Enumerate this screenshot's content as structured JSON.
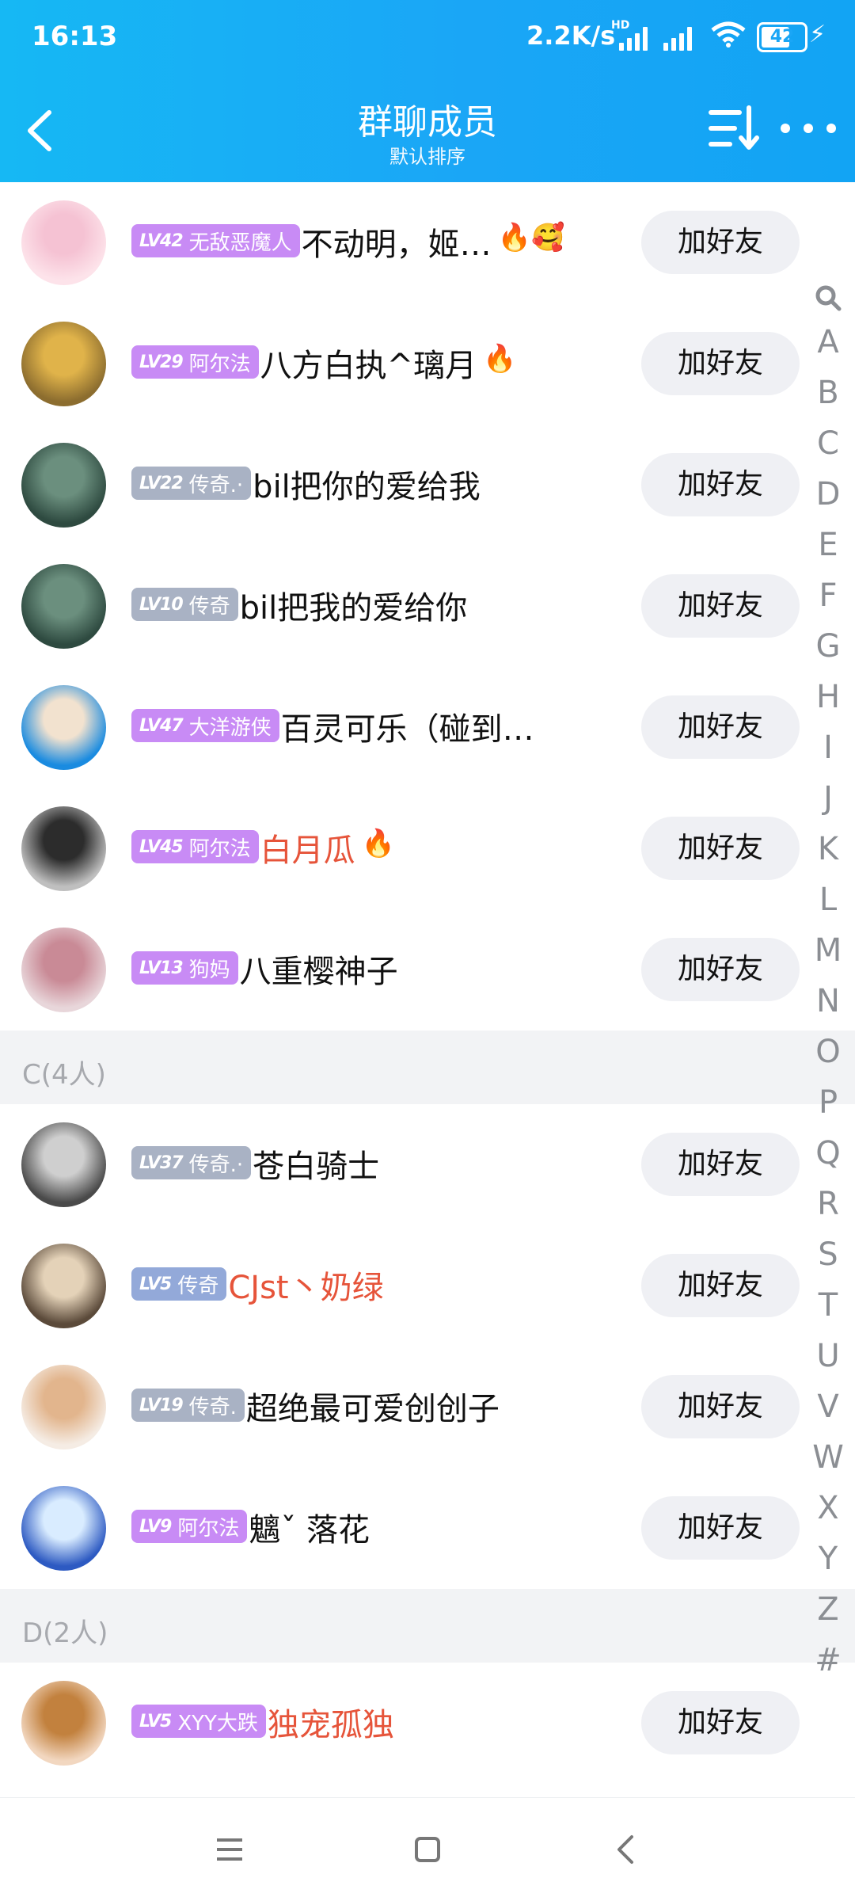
{
  "status_bar": {
    "time": "16:13",
    "net_speed": "2.2K/s",
    "hd": "HD",
    "battery": "42"
  },
  "header": {
    "title": "群聊成员",
    "subtitle": "默认排序",
    "back_icon": "back-chevron-icon",
    "sort_icon": "sort-icon",
    "more_icon": "more-dots-icon"
  },
  "add_label": "加好友",
  "members_top": [
    {
      "lv": "LV42",
      "badge": "无敌恶魔人",
      "badge_color": "#c88bf5",
      "name": "不动明，姬…",
      "name_color": "#111111",
      "emoji": "🔥🥰"
    },
    {
      "lv": "LV29",
      "badge": "阿尔法",
      "badge_color": "#c88bf5",
      "name": "八方白执^璃月",
      "name_color": "#111111",
      "emoji": "🔥"
    },
    {
      "lv": "LV22",
      "badge": "传奇.·",
      "badge_color": "#a9b2c4",
      "name": "bil把你的爱给我",
      "name_color": "#111111",
      "emoji": ""
    },
    {
      "lv": "LV10",
      "badge": "传奇",
      "badge_color": "#a9b2c4",
      "name": "bil把我的爱给你",
      "name_color": "#111111",
      "emoji": ""
    },
    {
      "lv": "LV47",
      "badge": "大洋游侠",
      "badge_color": "#c88bf5",
      "name": "百灵可乐（碰到…",
      "name_color": "#111111",
      "emoji": ""
    },
    {
      "lv": "LV45",
      "badge": "阿尔法",
      "badge_color": "#c88bf5",
      "name": "白月瓜",
      "name_color": "#e6543a",
      "emoji": "🔥"
    },
    {
      "lv": "LV13",
      "badge": "狗妈",
      "badge_color": "#c88bf5",
      "name": "八重樱神子",
      "name_color": "#111111",
      "emoji": ""
    }
  ],
  "section_c": "C(4人)",
  "members_c": [
    {
      "lv": "LV37",
      "badge": "传奇.·",
      "badge_color": "#a9b2c4",
      "name": "苍白骑士",
      "name_color": "#111111",
      "emoji": ""
    },
    {
      "lv": "LV5",
      "badge": "传奇",
      "badge_color": "#93a9d9",
      "name": "CJst丶奶绿",
      "name_color": "#e6543a",
      "emoji": ""
    },
    {
      "lv": "LV19",
      "badge": "传奇.",
      "badge_color": "#a9b2c4",
      "name": "超绝最可爱创创子",
      "name_color": "#111111",
      "emoji": ""
    },
    {
      "lv": "LV9",
      "badge": "阿尔法",
      "badge_color": "#c88bf5",
      "name": "魑ˇ  落花",
      "name_color": "#111111",
      "emoji": ""
    }
  ],
  "section_d": "D(2人)",
  "members_d": [
    {
      "lv": "LV5",
      "badge": "XYY大跌",
      "badge_color": "#c88bf5",
      "name": "独宠孤独",
      "name_color": "#e6543a",
      "emoji": ""
    }
  ],
  "index_letters": [
    "A",
    "B",
    "C",
    "D",
    "E",
    "F",
    "G",
    "H",
    "I",
    "J",
    "K",
    "L",
    "M",
    "N",
    "O",
    "P",
    "Q",
    "R",
    "S",
    "T",
    "U",
    "V",
    "W",
    "X",
    "Y",
    "Z",
    "#"
  ],
  "nav": [
    "menu-icon",
    "home-square-icon",
    "back-triangle-icon"
  ]
}
